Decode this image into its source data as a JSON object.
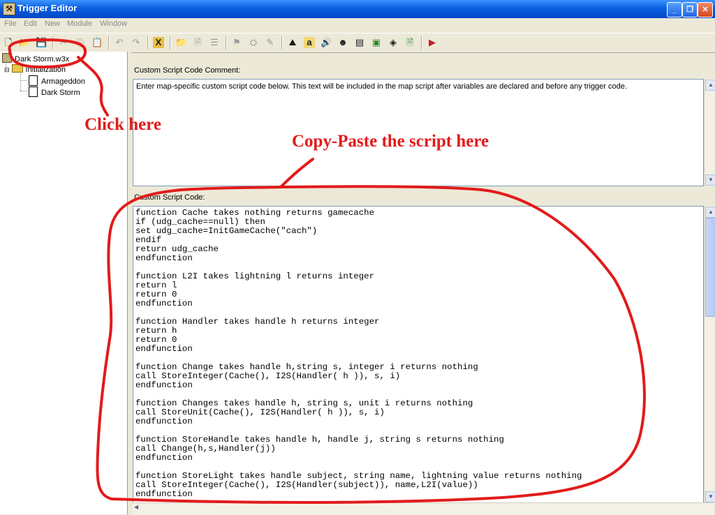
{
  "window": {
    "title": "Trigger Editor"
  },
  "menu": [
    "File",
    "Edit",
    "New",
    "Module",
    "Window"
  ],
  "tree": {
    "root": "Dark Storm.w3x",
    "category": "Initialization",
    "triggers": [
      "Armageddon",
      "Dark Storm"
    ]
  },
  "comment": {
    "label": "Custom Script Code Comment:",
    "text": "Enter map-specific custom script code below.  This text will be included in the map script after variables are declared and before any trigger code."
  },
  "code": {
    "label": "Custom Script Code:",
    "lines": [
      "function Cache takes nothing returns gamecache",
      "if (udg_cache==null) then",
      "set udg_cache=InitGameCache(\"cach\")",
      "endif",
      "return udg_cache",
      "endfunction",
      "",
      "function L2I takes lightning l returns integer",
      "return l",
      "return 0",
      "endfunction",
      "",
      "function Handler takes handle h returns integer",
      "return h",
      "return 0",
      "endfunction",
      "",
      "function Change takes handle h,string s, integer i returns nothing",
      "call StoreInteger(Cache(), I2S(Handler( h )), s, i)",
      "endfunction",
      "",
      "function Changes takes handle h, string s, unit i returns nothing",
      "call StoreUnit(Cache(), I2S(Handler( h )), s, i)",
      "endfunction",
      "",
      "function StoreHandle takes handle h, handle j, string s returns nothing",
      "call Change(h,s,Handler(j))",
      "endfunction",
      "",
      "function StoreLight takes handle subject, string name, lightning value returns nothing",
      "call StoreInteger(Cache(), I2S(Handler(subject)), name,L2I(value))",
      "endfunction"
    ]
  },
  "annotations": {
    "click_here": "Click here",
    "paste_here": "Copy-Paste the script here",
    "color": "#e21b1b"
  },
  "toolbar_glyphs": {
    "custom_text": "X",
    "abilities": "a"
  }
}
